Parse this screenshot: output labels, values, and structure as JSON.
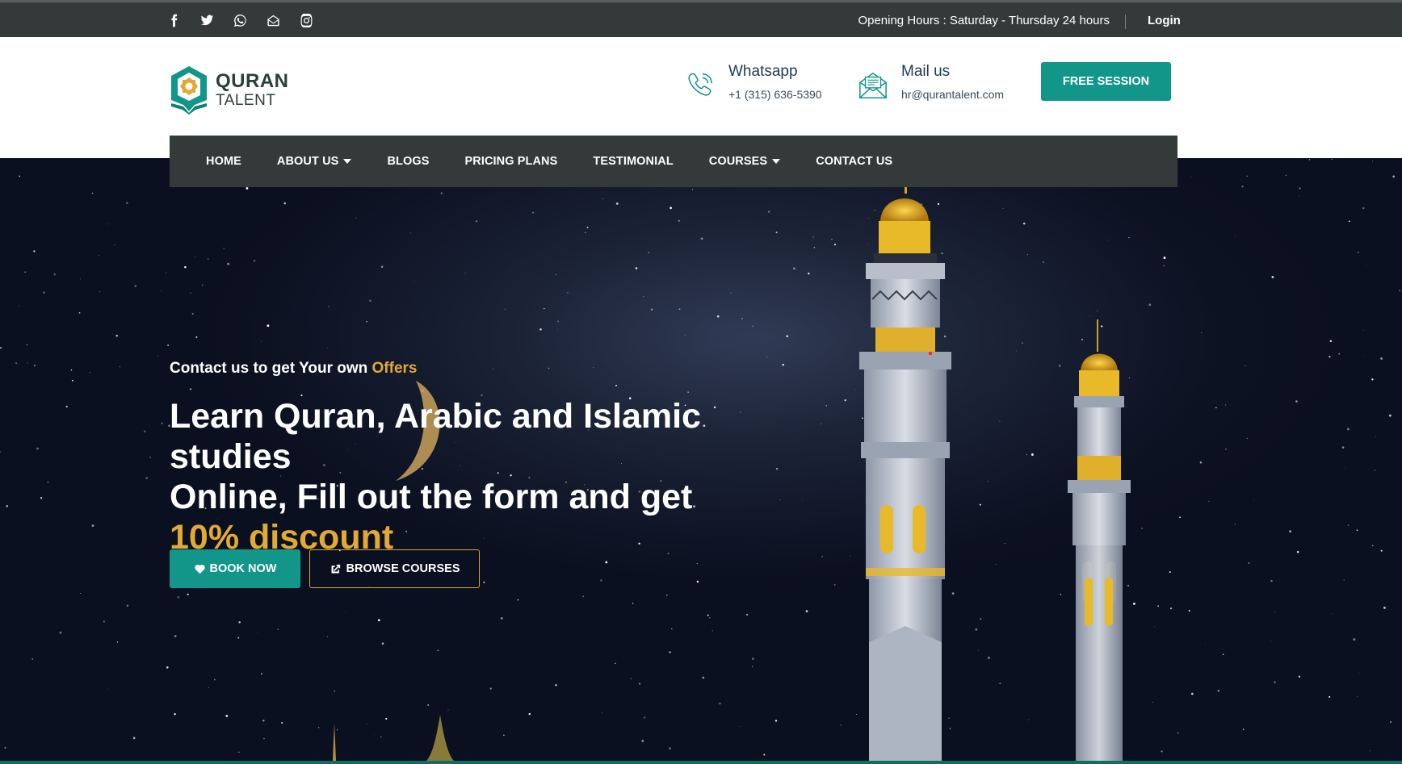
{
  "topbar": {
    "social": [
      {
        "icon": "facebook-icon"
      },
      {
        "icon": "twitter-icon"
      },
      {
        "icon": "whatsapp-icon"
      },
      {
        "icon": "email-icon"
      },
      {
        "icon": "instagram-icon"
      }
    ],
    "hours": "Opening Hours : Saturday - Thursday 24 hours",
    "login": "Login"
  },
  "brand": {
    "line1": "QURAN",
    "line2": "TALENT"
  },
  "contacts": {
    "whatsapp_title": "Whatsapp",
    "whatsapp_value": "+1 (315) 636-5390",
    "mail_title": "Mail us",
    "mail_value": "hr@qurantalent.com"
  },
  "header": {
    "free_session": "FREE SESSION"
  },
  "nav": {
    "items": [
      {
        "label": "HOME"
      },
      {
        "label": "ABOUT US"
      },
      {
        "label": "BLOGS"
      },
      {
        "label": "PRICING PLANS"
      },
      {
        "label": "TESTIMONIAL"
      },
      {
        "label": "COURSES"
      },
      {
        "label": "CONTACT US"
      }
    ]
  },
  "hero": {
    "tagline_main": "Contact us to get Your own ",
    "tagline_accent": "Offers",
    "headline_line1": "Learn Quran, Arabic and Islamic studies",
    "headline_line2": "Online, Fill out the form and get",
    "headline_accent": "10% discount",
    "book_label": "BOOK NOW",
    "browse_label": "BROWSE COURSES"
  },
  "colors": {
    "accent_teal": "#12968a",
    "accent_gold": "#e2a934",
    "bar_dark": "#343a3a"
  }
}
